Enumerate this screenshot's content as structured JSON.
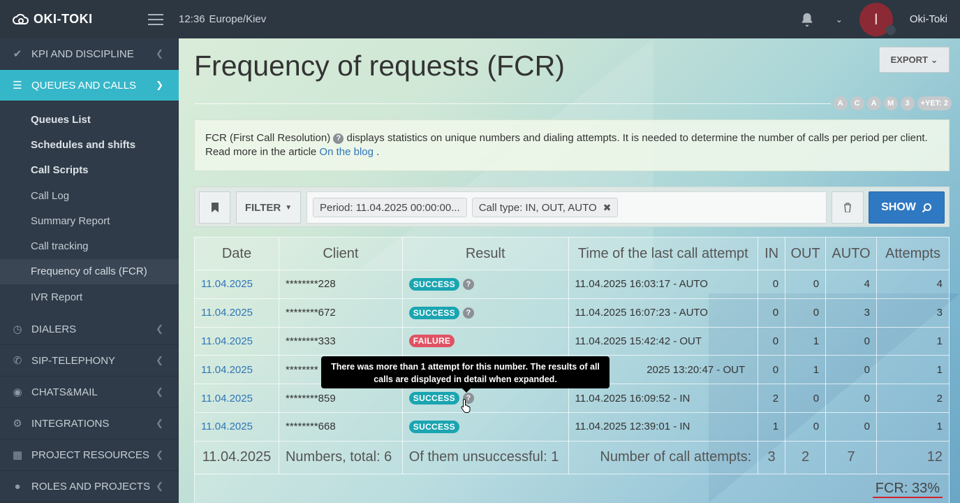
{
  "app": {
    "logo_text": "OKI-TOKI",
    "time": "12:36",
    "timezone": "Europe/Kiev",
    "user_initial": "I",
    "username": "Oki-Toki"
  },
  "sidebar": {
    "sections_top": [
      {
        "label": "KPI AND DISCIPLINE",
        "icon": "check-icon"
      }
    ],
    "active_section": {
      "label": "QUEUES AND CALLS",
      "icon": "list-icon"
    },
    "sub_items": [
      {
        "label": "Queues List"
      },
      {
        "label": "Schedules and shifts"
      },
      {
        "label": "Call Scripts"
      },
      {
        "label": "Call Log"
      },
      {
        "label": "Summary Report"
      },
      {
        "label": "Call tracking"
      },
      {
        "label": "Frequency of calls (FCR)"
      },
      {
        "label": "IVR Report"
      }
    ],
    "sections_bottom": [
      {
        "label": "DIALERS",
        "icon": "clock-icon"
      },
      {
        "label": "SIP-TELEPHONY",
        "icon": "phone-icon"
      },
      {
        "label": "CHATS&MAIL",
        "icon": "chat-icon"
      },
      {
        "label": "INTEGRATIONS",
        "icon": "gears-icon"
      },
      {
        "label": "PROJECT RESOURCES",
        "icon": "grid-icon"
      },
      {
        "label": "ROLES AND PROJECTS",
        "icon": "toggle-icon"
      }
    ]
  },
  "page": {
    "title": "Frequency of requests (FCR)",
    "export_label": "EXPORT",
    "chips": [
      "A",
      "C",
      "A",
      "M",
      "3",
      "+YET: 2"
    ],
    "info": {
      "prefix": "FCR (First Call Resolution)",
      "text": " displays statistics on unique numbers and dialing attempts. It is needed to determine the number of calls per period per client. Read more in the article ",
      "link": "On the blog",
      "suffix": " ."
    }
  },
  "filters": {
    "filter_label": "FILTER",
    "period_tag": "Period: 11.04.2025 00:00:00...",
    "calltype_tag": "Call type: IN, OUT, AUTO",
    "show_label": "SHOW"
  },
  "table": {
    "headers": [
      "Date",
      "Client",
      "Result",
      "Time of the last call attempt",
      "IN",
      "OUT",
      "AUTO",
      "Attempts"
    ],
    "rows": [
      {
        "date": "11.04.2025",
        "client": "********228",
        "result": "SUCCESS",
        "help": true,
        "last": "11.04.2025 16:03:17 - AUTO",
        "in": "0",
        "out": "0",
        "auto": "4",
        "attempts": "4"
      },
      {
        "date": "11.04.2025",
        "client": "********672",
        "result": "SUCCESS",
        "help": true,
        "last": "11.04.2025 16:07:23 - AUTO",
        "in": "0",
        "out": "0",
        "auto": "3",
        "attempts": "3"
      },
      {
        "date": "11.04.2025",
        "client": "********333",
        "result": "FAILURE",
        "help": false,
        "last": "11.04.2025 15:42:42 - OUT",
        "in": "0",
        "out": "1",
        "auto": "0",
        "attempts": "1"
      },
      {
        "date": "11.04.2025",
        "client": "********",
        "result": "",
        "help": false,
        "last": "2025 13:20:47 - OUT",
        "in": "0",
        "out": "1",
        "auto": "0",
        "attempts": "1"
      },
      {
        "date": "11.04.2025",
        "client": "********859",
        "result": "SUCCESS",
        "help": true,
        "last": "11.04.2025 16:09:52 - IN",
        "in": "2",
        "out": "0",
        "auto": "0",
        "attempts": "2"
      },
      {
        "date": "11.04.2025",
        "client": "********668",
        "result": "SUCCESS",
        "help": false,
        "last": "11.04.2025 12:39:01 - IN",
        "in": "1",
        "out": "0",
        "auto": "0",
        "attempts": "1"
      }
    ],
    "totals": {
      "date": "11.04.2025",
      "numbers": "Numbers, total: 6",
      "unsuccessful": "Of them unsuccessful: 1",
      "attempts_label": "Number of call attempts:",
      "in": "3",
      "out": "2",
      "auto": "7",
      "attempts": "12"
    },
    "fcr": "FCR: 33%"
  },
  "tooltip": {
    "text": "There was more than 1 attempt for this number. The results of all calls are displayed in detail when expanded."
  },
  "colors": {
    "accent": "#36b7c9",
    "primary": "#2f78c2",
    "success": "#1aa5b1",
    "failure": "#e05263",
    "topbar": "#2d3742",
    "sidebar": "#2f3b48"
  }
}
